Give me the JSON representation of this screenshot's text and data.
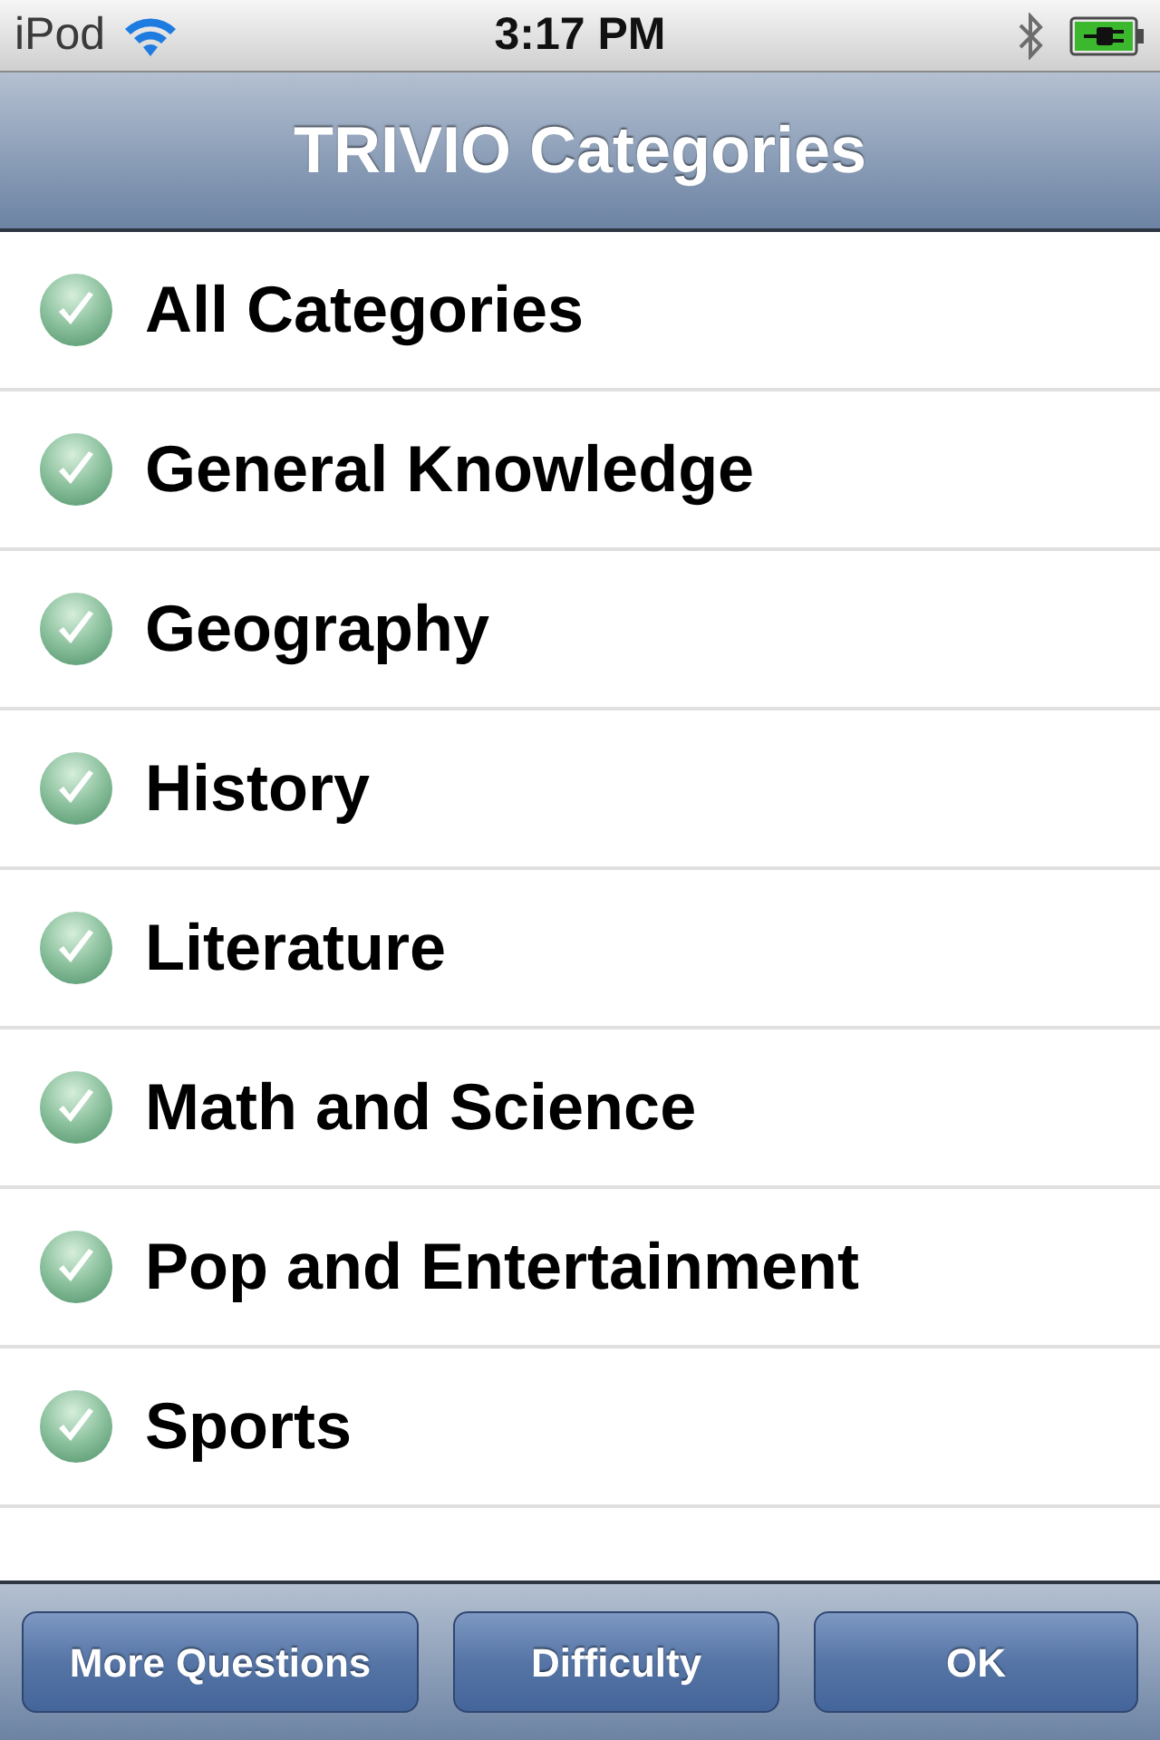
{
  "status_bar": {
    "carrier": "iPod",
    "time": "3:17 PM"
  },
  "nav_bar": {
    "title": "TRIVIO Categories"
  },
  "categories": [
    {
      "label": "All Categories",
      "checked": true
    },
    {
      "label": "General Knowledge",
      "checked": true
    },
    {
      "label": "Geography",
      "checked": true
    },
    {
      "label": "History",
      "checked": true
    },
    {
      "label": "Literature",
      "checked": true
    },
    {
      "label": "Math and Science",
      "checked": true
    },
    {
      "label": "Pop and Entertainment",
      "checked": true
    },
    {
      "label": "Sports",
      "checked": true
    }
  ],
  "toolbar": {
    "buttons": [
      {
        "label": "More Questions"
      },
      {
        "label": "Difficulty"
      },
      {
        "label": "OK"
      }
    ]
  }
}
